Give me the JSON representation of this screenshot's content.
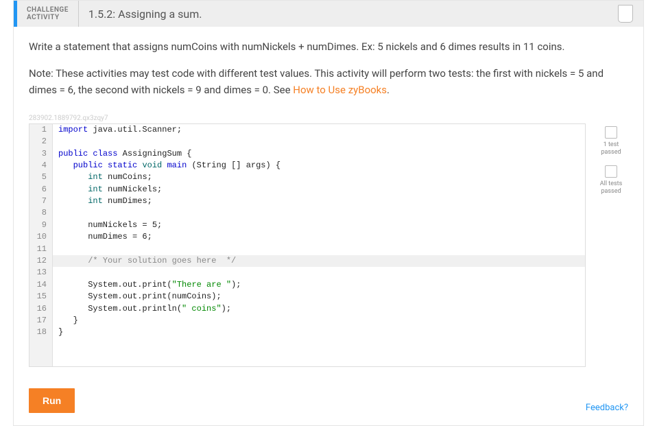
{
  "header": {
    "label_line1": "CHALLENGE",
    "label_line2": "ACTIVITY",
    "title": "1.5.2: Assigning a sum."
  },
  "prompt": {
    "p1": "Write a statement that assigns numCoins with numNickels + numDimes. Ex: 5 nickels and 6 dimes results in 11 coins.",
    "p2a": "Note: These activities may test code with different test values. This activity will perform two tests: the first with nickels = 5 and dimes = 6, the second with nickels = 9 and dimes = 0. See ",
    "p2link": "How to Use zyBooks",
    "p2b": "."
  },
  "watermark": "283902.1889792.qx3zqy7",
  "code": [
    {
      "n": 1,
      "hl": false,
      "tokens": [
        {
          "cls": "kw",
          "t": "import"
        },
        {
          "cls": "plain",
          "t": " java.util.Scanner;"
        }
      ]
    },
    {
      "n": 2,
      "hl": false,
      "tokens": [
        {
          "cls": "plain",
          "t": ""
        }
      ]
    },
    {
      "n": 3,
      "hl": false,
      "tokens": [
        {
          "cls": "kw",
          "t": "public"
        },
        {
          "cls": "plain",
          "t": " "
        },
        {
          "cls": "kw",
          "t": "class"
        },
        {
          "cls": "plain",
          "t": " AssigningSum {"
        }
      ]
    },
    {
      "n": 4,
      "hl": false,
      "tokens": [
        {
          "cls": "plain",
          "t": "   "
        },
        {
          "cls": "kw",
          "t": "public"
        },
        {
          "cls": "plain",
          "t": " "
        },
        {
          "cls": "kw",
          "t": "static"
        },
        {
          "cls": "plain",
          "t": " "
        },
        {
          "cls": "type",
          "t": "void"
        },
        {
          "cls": "plain",
          "t": " "
        },
        {
          "cls": "kw",
          "t": "main"
        },
        {
          "cls": "plain",
          "t": " (String [] args) {"
        }
      ]
    },
    {
      "n": 5,
      "hl": false,
      "tokens": [
        {
          "cls": "plain",
          "t": "      "
        },
        {
          "cls": "type",
          "t": "int"
        },
        {
          "cls": "plain",
          "t": " numCoins;"
        }
      ]
    },
    {
      "n": 6,
      "hl": false,
      "tokens": [
        {
          "cls": "plain",
          "t": "      "
        },
        {
          "cls": "type",
          "t": "int"
        },
        {
          "cls": "plain",
          "t": " numNickels;"
        }
      ]
    },
    {
      "n": 7,
      "hl": false,
      "tokens": [
        {
          "cls": "plain",
          "t": "      "
        },
        {
          "cls": "type",
          "t": "int"
        },
        {
          "cls": "plain",
          "t": " numDimes;"
        }
      ]
    },
    {
      "n": 8,
      "hl": false,
      "tokens": [
        {
          "cls": "plain",
          "t": ""
        }
      ]
    },
    {
      "n": 9,
      "hl": false,
      "tokens": [
        {
          "cls": "plain",
          "t": "      numNickels = 5;"
        }
      ]
    },
    {
      "n": 10,
      "hl": false,
      "tokens": [
        {
          "cls": "plain",
          "t": "      numDimes = 6;"
        }
      ]
    },
    {
      "n": 11,
      "hl": false,
      "tokens": [
        {
          "cls": "plain",
          "t": ""
        }
      ]
    },
    {
      "n": 12,
      "hl": true,
      "tokens": [
        {
          "cls": "plain",
          "t": "      "
        },
        {
          "cls": "doc",
          "t": "/* Your solution goes here  */"
        }
      ]
    },
    {
      "n": 13,
      "hl": false,
      "tokens": [
        {
          "cls": "plain",
          "t": ""
        }
      ]
    },
    {
      "n": 14,
      "hl": false,
      "tokens": [
        {
          "cls": "plain",
          "t": "      System.out.print("
        },
        {
          "cls": "str",
          "t": "\"There are \""
        },
        {
          "cls": "plain",
          "t": ");"
        }
      ]
    },
    {
      "n": 15,
      "hl": false,
      "tokens": [
        {
          "cls": "plain",
          "t": "      System.out.print(numCoins);"
        }
      ]
    },
    {
      "n": 16,
      "hl": false,
      "tokens": [
        {
          "cls": "plain",
          "t": "      System.out.println("
        },
        {
          "cls": "str",
          "t": "\" coins\""
        },
        {
          "cls": "plain",
          "t": ");"
        }
      ]
    },
    {
      "n": 17,
      "hl": false,
      "tokens": [
        {
          "cls": "plain",
          "t": "   }"
        }
      ]
    },
    {
      "n": 18,
      "hl": false,
      "tokens": [
        {
          "cls": "plain",
          "t": "}"
        }
      ]
    }
  ],
  "tests": [
    {
      "label_l1": "1 test",
      "label_l2": "passed"
    },
    {
      "label_l1": "All tests",
      "label_l2": "passed"
    }
  ],
  "run_label": "Run",
  "feedback_label": "Feedback?"
}
